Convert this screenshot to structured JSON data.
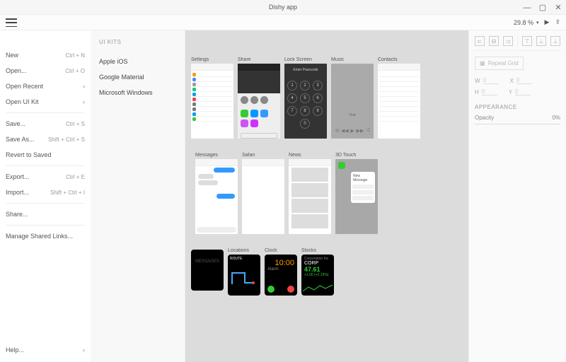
{
  "title": "Dishy app",
  "window_buttons": [
    "min",
    "restore",
    "close"
  ],
  "toolbar": {
    "zoom": "29.8 %"
  },
  "hamburger_menu": [
    {
      "label": "New",
      "shortcut": "Ctrl + N"
    },
    {
      "label": "Open...",
      "shortcut": "Ctrl + O"
    },
    {
      "label": "Open Recent",
      "chev": true
    },
    {
      "label": "Open UI Kit",
      "chev": true
    },
    {
      "sep": true
    },
    {
      "label": "Save...",
      "shortcut": "Ctrl + S"
    },
    {
      "label": "Save As...",
      "shortcut": "Shift + Ctrl + S"
    },
    {
      "label": "Revert to Saved"
    },
    {
      "sep": true
    },
    {
      "label": "Export...",
      "shortcut": "Ctrl + E"
    },
    {
      "label": "Import...",
      "shortcut": "Shift + Ctrl + I"
    },
    {
      "sep": true
    },
    {
      "label": "Share..."
    },
    {
      "sep": true
    },
    {
      "label": "Manage Shared Links..."
    }
  ],
  "help_item": {
    "label": "Help...",
    "chev": true
  },
  "kitpanel": {
    "title": "UI KITS",
    "items": [
      "Apple iOS",
      "Google Material",
      "Microsoft Windows"
    ]
  },
  "artboards": {
    "row1": [
      {
        "label": "Settings",
        "kind": "settings"
      },
      {
        "label": "Share",
        "kind": "share"
      },
      {
        "label": "Lock Screen",
        "kind": "lock"
      },
      {
        "label": "Music",
        "kind": "music"
      },
      {
        "label": "Contacts",
        "kind": "contacts"
      }
    ],
    "row2": [
      {
        "label": "Messages",
        "kind": "messages"
      },
      {
        "label": "Safari",
        "kind": "safari"
      },
      {
        "label": "News",
        "kind": "news"
      },
      {
        "label": "3D Touch",
        "kind": "touch3d"
      }
    ],
    "row3": [
      {
        "label": "",
        "kind": "watch-dark"
      },
      {
        "label": "Locations",
        "kind": "watch-map"
      },
      {
        "label": "Clock",
        "kind": "watch-clock"
      },
      {
        "label": "Stocks",
        "kind": "watch-stocks"
      }
    ]
  },
  "clock": {
    "time": "10:00",
    "label": "Alarm"
  },
  "stocks": {
    "sym": "CORP",
    "price": "47.61",
    "change": "+1.00 (+2.15%)",
    "sub": "Corporation Inc"
  },
  "lock": {
    "label": "Enter Passcode"
  },
  "props": {
    "repeat": "Repeat Grid",
    "w": {
      "lbl": "W",
      "val": "0"
    },
    "x": {
      "lbl": "X",
      "val": "0"
    },
    "h": {
      "lbl": "H",
      "val": "0"
    },
    "y": {
      "lbl": "Y",
      "val": "0"
    },
    "appearance": "APPEARANCE",
    "opacity_lbl": "Opacity",
    "opacity_val": "0%"
  }
}
